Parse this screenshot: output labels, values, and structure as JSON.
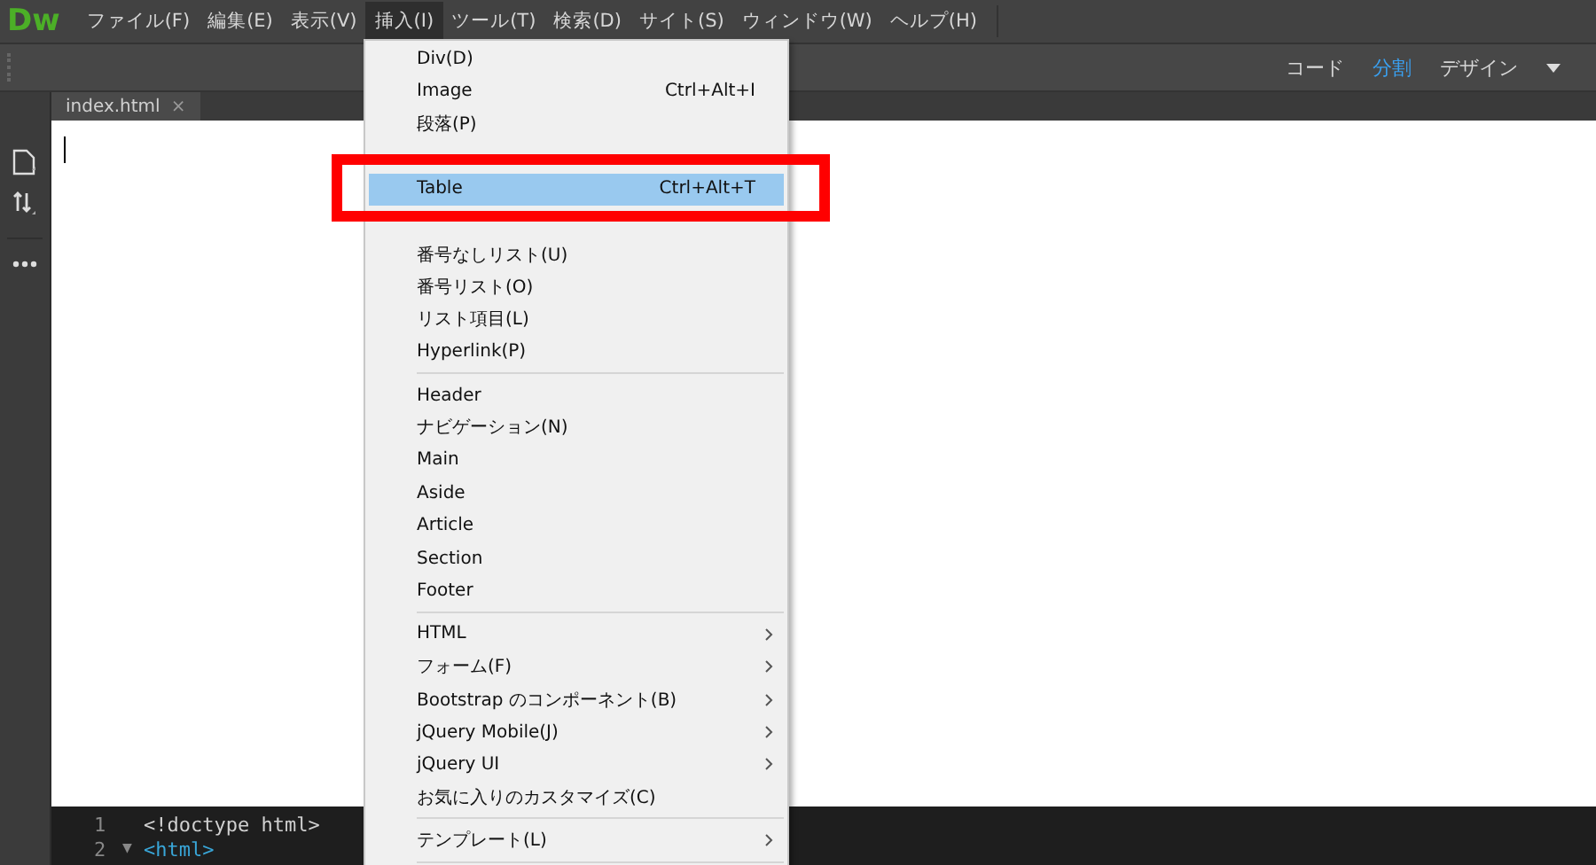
{
  "logo": "Dw",
  "menu_bar": [
    {
      "label": "ファイル(F)",
      "selected": false
    },
    {
      "label": "編集(E)",
      "selected": false
    },
    {
      "label": "表示(V)",
      "selected": false
    },
    {
      "label": "挿入(I)",
      "selected": true
    },
    {
      "label": "ツール(T)",
      "selected": false
    },
    {
      "label": "検索(D)",
      "selected": false
    },
    {
      "label": "サイト(S)",
      "selected": false
    },
    {
      "label": "ウィンドウ(W)",
      "selected": false
    },
    {
      "label": "ヘルプ(H)",
      "selected": false
    }
  ],
  "view_switch": [
    {
      "label": "コード",
      "selected": false
    },
    {
      "label": "分割",
      "selected": true
    },
    {
      "label": "デザイン",
      "selected": false
    }
  ],
  "tabs": [
    {
      "label": "index.html",
      "close": "×",
      "selected": true
    }
  ],
  "insert_menu": [
    {
      "kind": "item",
      "label": "Div(D)",
      "selected": false
    },
    {
      "kind": "item",
      "label": "Image",
      "shortcut": "Ctrl+Alt+I",
      "selected": false
    },
    {
      "kind": "item",
      "label": "段落(P)",
      "selected": false
    },
    {
      "kind": "covered"
    },
    {
      "kind": "item",
      "label": "Table",
      "shortcut": "Ctrl+Alt+T",
      "selected": true
    },
    {
      "kind": "covered"
    },
    {
      "kind": "item",
      "label": "番号なしリスト(U)",
      "selected": false
    },
    {
      "kind": "item",
      "label": "番号リスト(O)",
      "selected": false
    },
    {
      "kind": "item",
      "label": "リスト項目(L)",
      "selected": false
    },
    {
      "kind": "item",
      "label": "Hyperlink(P)",
      "selected": false
    },
    {
      "kind": "separator"
    },
    {
      "kind": "item",
      "label": "Header",
      "selected": false
    },
    {
      "kind": "item",
      "label": "ナビゲーション(N)",
      "selected": false
    },
    {
      "kind": "item",
      "label": "Main",
      "selected": false
    },
    {
      "kind": "item",
      "label": "Aside",
      "selected": false
    },
    {
      "kind": "item",
      "label": "Article",
      "selected": false
    },
    {
      "kind": "item",
      "label": "Section",
      "selected": false
    },
    {
      "kind": "item",
      "label": "Footer",
      "selected": false
    },
    {
      "kind": "separator"
    },
    {
      "kind": "item",
      "label": "HTML",
      "submenu": true,
      "selected": false
    },
    {
      "kind": "item",
      "label": "フォーム(F)",
      "submenu": true,
      "selected": false
    },
    {
      "kind": "item",
      "label": "Bootstrap のコンポーネント(B)",
      "submenu": true,
      "selected": false
    },
    {
      "kind": "item",
      "label": "jQuery Mobile(J)",
      "submenu": true,
      "selected": false
    },
    {
      "kind": "item",
      "label": "jQuery UI",
      "submenu": true,
      "selected": false
    },
    {
      "kind": "item",
      "label": "お気に入りのカスタマイズ(C)",
      "selected": false
    },
    {
      "kind": "separator"
    },
    {
      "kind": "item",
      "label": "テンプレート(L)",
      "submenu": true,
      "selected": false
    },
    {
      "kind": "separator"
    }
  ],
  "code_lines": [
    {
      "number": "1",
      "code": "<!doctype html>"
    },
    {
      "number": "2",
      "fold": "▼",
      "code": "<html>"
    }
  ]
}
